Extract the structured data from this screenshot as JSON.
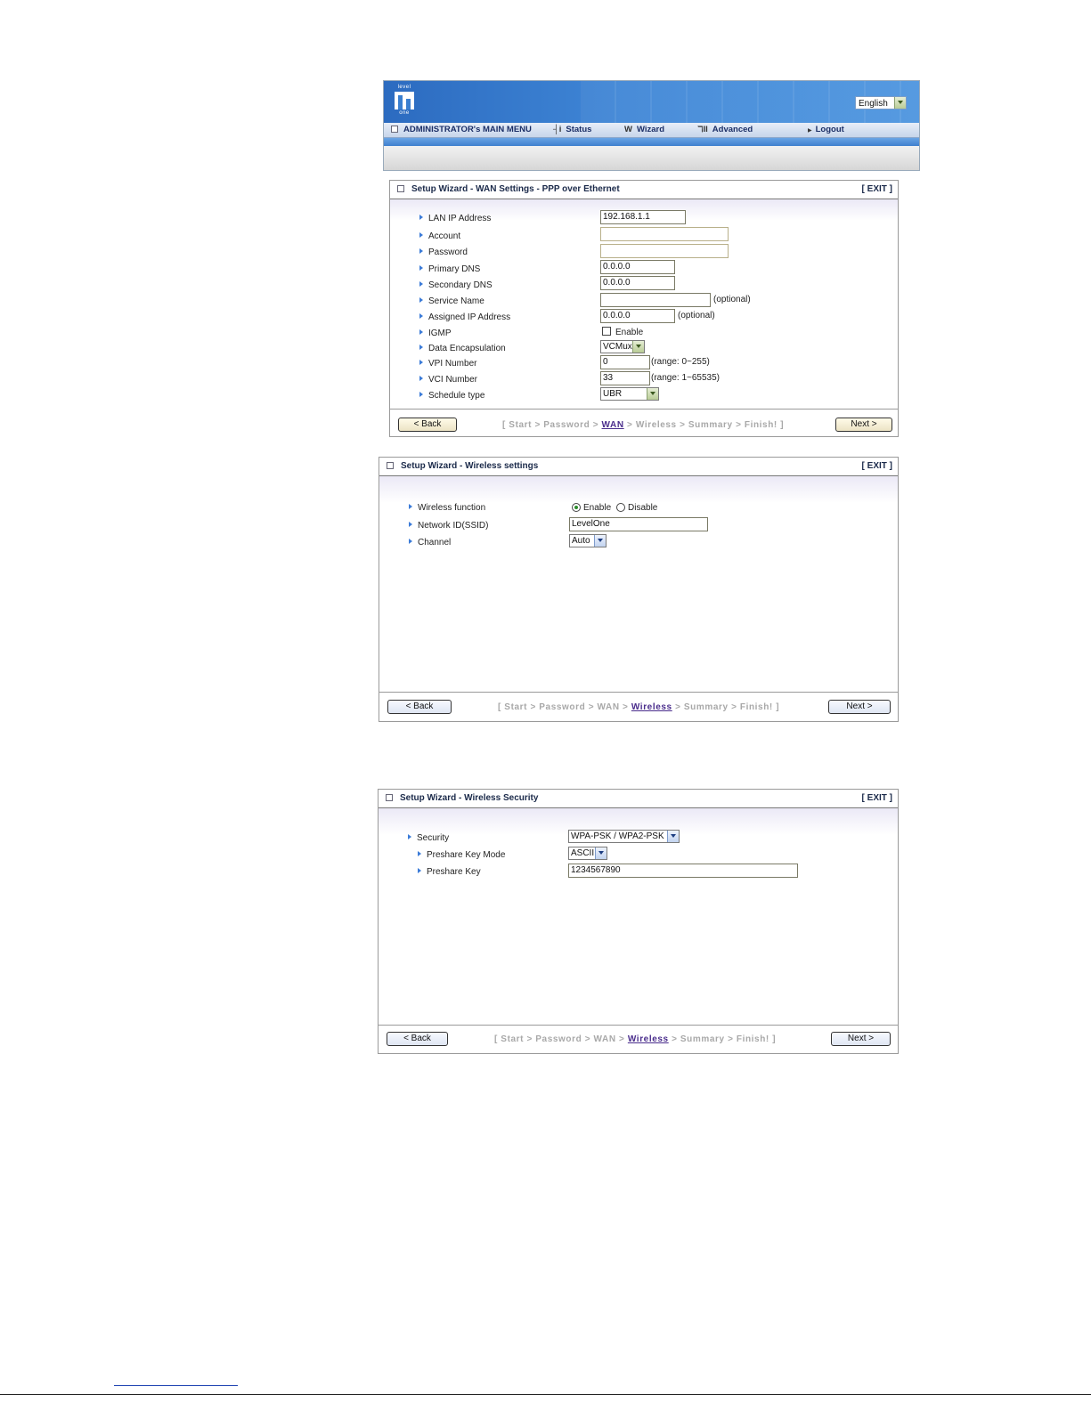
{
  "header": {
    "logo_top": "level",
    "logo_bottom": "one",
    "language": "English",
    "menu": {
      "main": "ADMINISTRATOR's MAIN MENU",
      "status": "Status",
      "wizard": "Wizard",
      "advanced": "Advanced",
      "logout": "Logout"
    }
  },
  "wan_panel": {
    "title": "Setup Wizard - WAN Settings - PPP over Ethernet",
    "exit": "[ EXIT ]",
    "fields": {
      "lan_ip": {
        "label": "LAN IP Address",
        "value": "192.168.1.1"
      },
      "account": {
        "label": "Account",
        "value": ""
      },
      "password": {
        "label": "Password",
        "value": ""
      },
      "primary_dns": {
        "label": "Primary DNS",
        "value": "0.0.0.0"
      },
      "secondary_dns": {
        "label": "Secondary DNS",
        "value": "0.0.0.0"
      },
      "service_name": {
        "label": "Service Name",
        "value": "",
        "note": "(optional)"
      },
      "assigned_ip": {
        "label": "Assigned IP Address",
        "value": "0.0.0.0",
        "note": "(optional)"
      },
      "igmp": {
        "label": "IGMP",
        "option": "Enable",
        "checked": false
      },
      "data_encap": {
        "label": "Data Encapsulation",
        "value": "VCMux"
      },
      "vpi": {
        "label": "VPI Number",
        "value": "0",
        "note": "(range: 0~255)"
      },
      "vci": {
        "label": "VCI Number",
        "value": "33",
        "note": "(range: 1~65535)"
      },
      "schedule": {
        "label": "Schedule type",
        "value": "UBR"
      }
    },
    "back": "< Back",
    "next": "Next >",
    "crumbs": {
      "open": "[ Start > Password > ",
      "current": "WAN",
      "rest": " > Wireless > Summary > Finish! ]"
    }
  },
  "wireless_panel": {
    "title": "Setup Wizard - Wireless settings",
    "exit": "[ EXIT ]",
    "fields": {
      "function": {
        "label": "Wireless function",
        "enable": "Enable",
        "disable": "Disable",
        "selected": "Enable"
      },
      "ssid": {
        "label": "Network ID(SSID)",
        "value": "LevelOne"
      },
      "channel": {
        "label": "Channel",
        "value": "Auto"
      }
    },
    "back": "< Back",
    "next": "Next >",
    "crumbs": {
      "open": "[ Start > Password > WAN > ",
      "current": "Wireless",
      "rest": " > Summary > Finish! ]"
    }
  },
  "security_panel": {
    "title": "Setup Wizard - Wireless Security",
    "exit": "[ EXIT ]",
    "fields": {
      "security": {
        "label": "Security",
        "value": "WPA-PSK / WPA2-PSK"
      },
      "key_mode": {
        "label": "Preshare Key Mode",
        "value": "ASCII"
      },
      "key": {
        "label": "Preshare Key",
        "value": "1234567890"
      }
    },
    "back": "< Back",
    "next": "Next >",
    "crumbs": {
      "open": "[ Start > Password > WAN > ",
      "current": "Wireless",
      "rest": " > Summary > Finish! ]"
    }
  }
}
